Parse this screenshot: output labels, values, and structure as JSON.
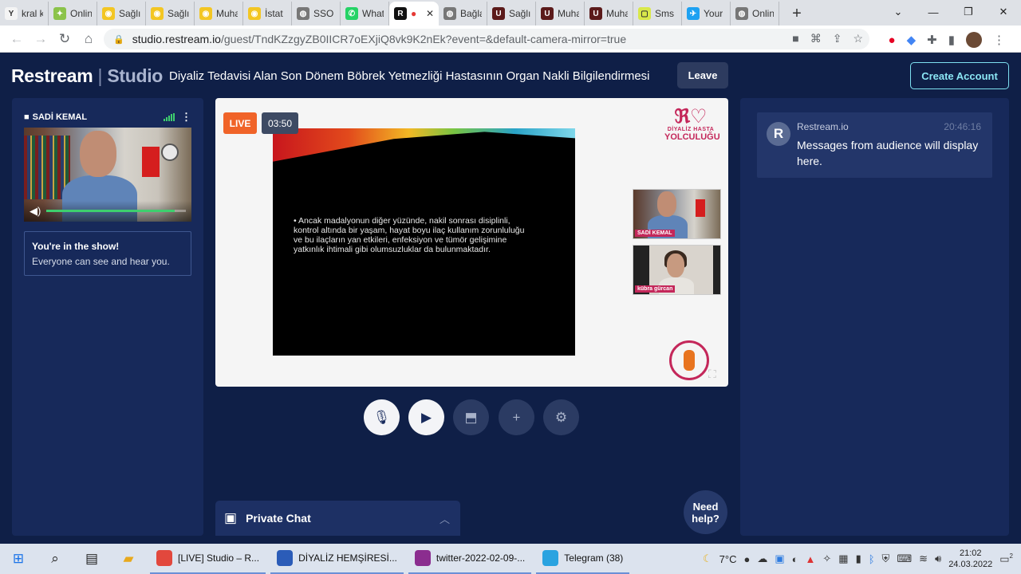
{
  "browser": {
    "tabs": [
      {
        "label": "kral k",
        "icon": "yandex-icon",
        "color": "#f4f4f4",
        "glyph": "Y"
      },
      {
        "label": "Onlin",
        "icon": "android-icon",
        "color": "#8bc34a",
        "glyph": "✦"
      },
      {
        "label": "Sağlı",
        "icon": "ministry-icon",
        "color": "#f3c623",
        "glyph": "◉"
      },
      {
        "label": "Sağlı",
        "icon": "ministry-icon",
        "color": "#f3c623",
        "glyph": "◉"
      },
      {
        "label": "Muha",
        "icon": "ministry-icon",
        "color": "#f3c623",
        "glyph": "◉"
      },
      {
        "label": "İstat",
        "icon": "ministry-icon",
        "color": "#f3c623",
        "glyph": "◉"
      },
      {
        "label": "SSO",
        "icon": "sso-icon",
        "color": "#777777",
        "glyph": "◍"
      },
      {
        "label": "What",
        "icon": "whatsapp-icon",
        "color": "#25d366",
        "glyph": "✆"
      },
      {
        "label": "",
        "icon": "restream-icon",
        "color": "#111111",
        "glyph": "R",
        "active": true
      },
      {
        "label": "Bağla",
        "icon": "globe-icon",
        "color": "#777777",
        "glyph": "◍"
      },
      {
        "label": "Sağlı",
        "icon": "uyap-icon",
        "color": "#5b1a1a",
        "glyph": "U"
      },
      {
        "label": "Muha",
        "icon": "uyap-icon",
        "color": "#5b1a1a",
        "glyph": "U"
      },
      {
        "label": "Muha",
        "icon": "uyap-icon",
        "color": "#5b1a1a",
        "glyph": "U"
      },
      {
        "label": "Sms",
        "icon": "sms-icon",
        "color": "#d9e84a",
        "glyph": "▢"
      },
      {
        "label": "Your",
        "icon": "twitter-icon",
        "color": "#1da1f2",
        "glyph": "✈"
      },
      {
        "label": "Onlin",
        "icon": "globe-icon",
        "color": "#777777",
        "glyph": "◍"
      }
    ],
    "new_tab": "+",
    "url_host": "studio.restream.io",
    "url_path": "/guest/TndKZzgyZB0IICR7oEXjiQ8vk9K2nEk?event=&default-camera-mirror=true"
  },
  "app": {
    "brand": "Restream",
    "brand_sep": "|",
    "brand_studio": "Studio",
    "show_title": "Diyaliz Tedavisi Alan Son Dönem Böbrek Yetmezliği Hastasının Organ Nakli Bilgilendirmesi",
    "leave_label": "Leave",
    "create_account_label": "Create Account"
  },
  "camera": {
    "name": "SADİ KEMAL",
    "menu": "⋮",
    "volume_level": 0.92
  },
  "inshow": {
    "title": "You're in the show!",
    "subtitle": "Everyone can see and hear you."
  },
  "stage": {
    "live_label": "LIVE",
    "timer": "03:50",
    "slide_text": "• Ancak madalyonun diğer yüzünde, nakil sonrası disiplinli, kontrol altında bir yaşam, hayat boyu ilaç kullanım zorunluluğu ve bu ilaçların yan etkileri, enfeksiyon ve tümör gelişimine yatkınlık ihtimali gibi olumsuzluklar da bulunmaktadır.",
    "logo_top_line1": "DİYALİZ HASTA",
    "logo_top_line2": "YOLCULUĞU",
    "pip1_label": "SADİ KEMAL",
    "pip2_label": "kübra gürcan"
  },
  "controls": [
    {
      "name": "microphone-button",
      "icon": "🎙",
      "state": "on"
    },
    {
      "name": "camera-button",
      "icon": "▶",
      "state": "on"
    },
    {
      "name": "share-screen-button",
      "icon": "⬒",
      "state": "off"
    },
    {
      "name": "add-button",
      "icon": "+",
      "state": "off"
    },
    {
      "name": "settings-button",
      "icon": "⚙",
      "state": "off"
    }
  ],
  "private_chat": {
    "label": "Private Chat"
  },
  "need_help": "Need help?",
  "chat": {
    "avatar": "R",
    "from": "Restream.io",
    "time": "20:46:16",
    "message": "Messages from audience will display here."
  },
  "taskbar": {
    "apps": [
      {
        "label": "[LIVE] Studio – R...",
        "color": "#e2483d"
      },
      {
        "label": "DİYALİZ HEMŞİRESİ...",
        "color": "#2b5cb8"
      },
      {
        "label": "twitter-2022-02-09-...",
        "color": "#8b2d8f"
      },
      {
        "label": "Telegram (38)",
        "color": "#2aa3e0"
      }
    ],
    "weather": "7°C",
    "time": "21:02",
    "date": "24.03.2022",
    "notifications": "2"
  }
}
